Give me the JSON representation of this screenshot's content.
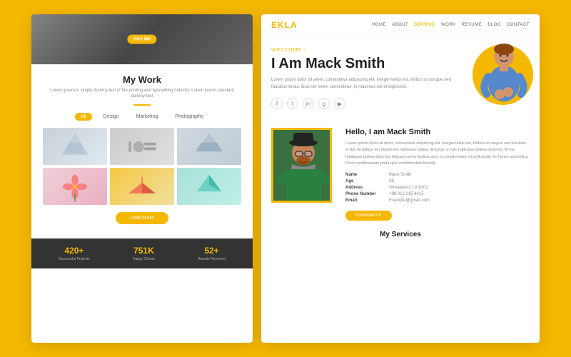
{
  "outer": {
    "bg_color": "#F5B800"
  },
  "left_panel": {
    "hero_btn": "Hire Me",
    "title": "My Work",
    "subtitle": "Lorem ipsum is simply dummy text of the printing and typesetting industry. Lorem ipsum standard dummy text",
    "filter_tabs": [
      "All",
      "Design",
      "Marketing",
      "Photography"
    ],
    "active_tab": "All",
    "load_more": "Load More",
    "stats": [
      {
        "number": "420+",
        "label": "Successful Projects"
      },
      {
        "number": "751K",
        "label": "Happy Clients"
      },
      {
        "number": "52+",
        "label": "Awards Received"
      }
    ]
  },
  "right_panel": {
    "logo": "EKLA",
    "nav_links": [
      "HOME",
      "ABOUT",
      "SERVICE",
      "WORK",
      "RESUME",
      "BLOG",
      "CONTACT"
    ],
    "active_nav": "SERVICE",
    "welcome_label": "WELCOME !",
    "hero_name": "I Am Mack Smith",
    "hero_desc": "Lorem ipsum dolor sit amet, consectetur adipiscing elit. Integer tellus est, finibus ut congue sed faucibus et dui. Duis vel lorem consectetur, in maximus est et dignissim.",
    "social_icons": [
      "f",
      "t",
      "in",
      "g+",
      "yt"
    ],
    "about_title": "Hello, I am Mack Smith",
    "about_desc": "Lorem ipsum dolor sit amet, consectetur adipiscing elit. Integer tellus est, finibus ut congue sed faucibus et dui. At duibus leo blandit leo habitasse platea dictumst. In hac habitasse platea dictumst. At hac habitasse platea dictumst. Aliquam porta facilisis arcu ut condimentum et sollicitudin. In Donec quis tellus. Proin condimentum porta quis condimentum blandit.",
    "info": [
      {
        "label": "Name",
        "value": "Mack Smith"
      },
      {
        "label": "Age",
        "value": "28"
      },
      {
        "label": "Address",
        "value": "Shreveport, LA 8101"
      },
      {
        "label": "Phone Number",
        "value": "+98 012 215 4415"
      },
      {
        "label": "Email",
        "value": "Example@gmail.com"
      }
    ],
    "download_btn": "Download CV",
    "my_services": "My Services"
  }
}
